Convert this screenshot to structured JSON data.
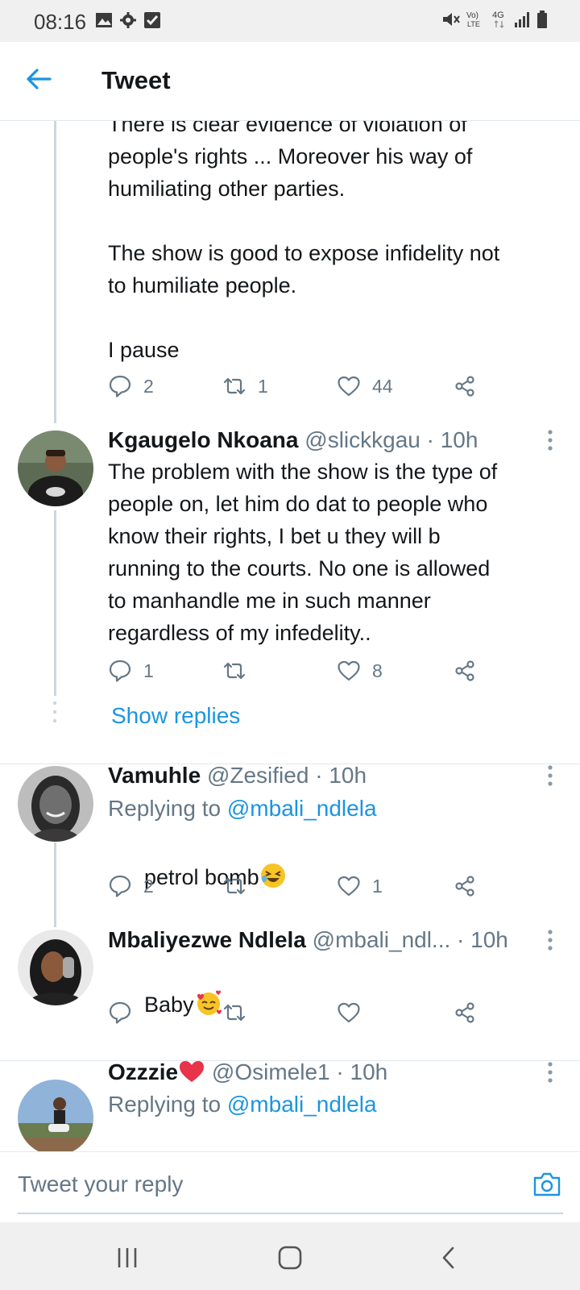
{
  "status_bar": {
    "time": "08:16"
  },
  "header": {
    "title": "Tweet"
  },
  "tweet1": {
    "text": "There is clear evidence of violation of\npeople's rights ... Moreover his way of\nhumiliating other parties.\n\nThe show is good to expose infidelity not\nto humiliate people.\n\nI pause",
    "reply_count": "2",
    "retweet_count": "1",
    "like_count": "44"
  },
  "tweet2": {
    "name": "Kgaugelo Nkoana",
    "meta": "@slickkgau · 10h",
    "text": "The problem with the show is the type of\npeople on, let him do dat to people who\nknow their rights, I bet u they will b\nrunning to the courts. No one is allowed\nto manhandle me in such manner\nregardless of my infedelity..",
    "reply_count": "1",
    "retweet_count": "",
    "like_count": "8",
    "show_replies": "Show replies"
  },
  "tweet3": {
    "name": "Vamuhle",
    "meta": "@Zesified · 10h",
    "replying_prefix": "Replying to ",
    "replying_handle": "@mbali_ndlela",
    "text": "petrol bomb",
    "reply_count": "2",
    "retweet_count": "",
    "like_count": "1"
  },
  "tweet4": {
    "name": "Mbaliyezwe Ndlela",
    "meta": "@mbali_ndl... · 10h",
    "text": "Baby",
    "reply_count": "",
    "retweet_count": "",
    "like_count": ""
  },
  "tweet5": {
    "name": "Ozzzie",
    "meta": "@Osimele1 · 10h",
    "replying_prefix": "Replying to ",
    "replying_handle": "@mbali_ndlela"
  },
  "reply_bar": {
    "placeholder": "Tweet your reply"
  },
  "colors": {
    "accent": "#1b95e0",
    "text": "#14171a",
    "secondary": "#657786",
    "divider": "#e1e8ed"
  }
}
